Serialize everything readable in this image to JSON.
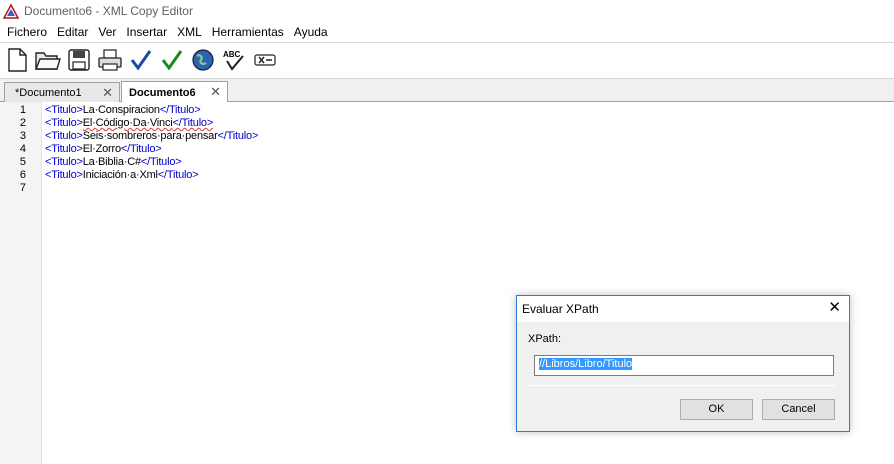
{
  "window": {
    "title": "Documento6 - XML Copy Editor"
  },
  "menu": [
    "Fichero",
    "Editar",
    "Ver",
    "Insertar",
    "XML",
    "Herramientas",
    "Ayuda"
  ],
  "toolbar": [
    {
      "icon": "new-document-icon"
    },
    {
      "icon": "open-folder-icon"
    },
    {
      "icon": "save-icon"
    },
    {
      "icon": "print-icon"
    },
    {
      "icon": "check-wellformed-icon"
    },
    {
      "icon": "validate-icon"
    },
    {
      "icon": "browser-icon"
    },
    {
      "icon": "spellcheck-icon"
    },
    {
      "icon": "xpath-icon"
    }
  ],
  "tabs": [
    {
      "label": "*Documento1",
      "active": false
    },
    {
      "label": "Documento6",
      "active": true
    }
  ],
  "editor": {
    "lines": [
      {
        "no": "1",
        "open": "<Titulo>",
        "text": "La·Conspiracion",
        "close": "</Titulo>"
      },
      {
        "no": "2",
        "open": "<Titulo>",
        "text": "El·Código·Da·Vinci",
        "close": "</Titulo>"
      },
      {
        "no": "3",
        "open": "<Titulo>",
        "text": "Seis·sombreros·para·pensar",
        "close": "</Titulo>"
      },
      {
        "no": "4",
        "open": "<Titulo>",
        "text": "El·Zorro",
        "close": "</Titulo>"
      },
      {
        "no": "5",
        "open": "<Titulo>",
        "text": "La·Biblia·C#",
        "close": "</Titulo>"
      },
      {
        "no": "6",
        "open": "<Titulo>",
        "text": "Iniciación·a·Xml",
        "close": "</Titulo>"
      },
      {
        "no": "7",
        "open": "",
        "text": "",
        "close": ""
      }
    ]
  },
  "dialog": {
    "title": "Evaluar XPath",
    "label": "XPath:",
    "value": "//Libros/Libro/Titulo",
    "ok": "OK",
    "cancel": "Cancel"
  }
}
